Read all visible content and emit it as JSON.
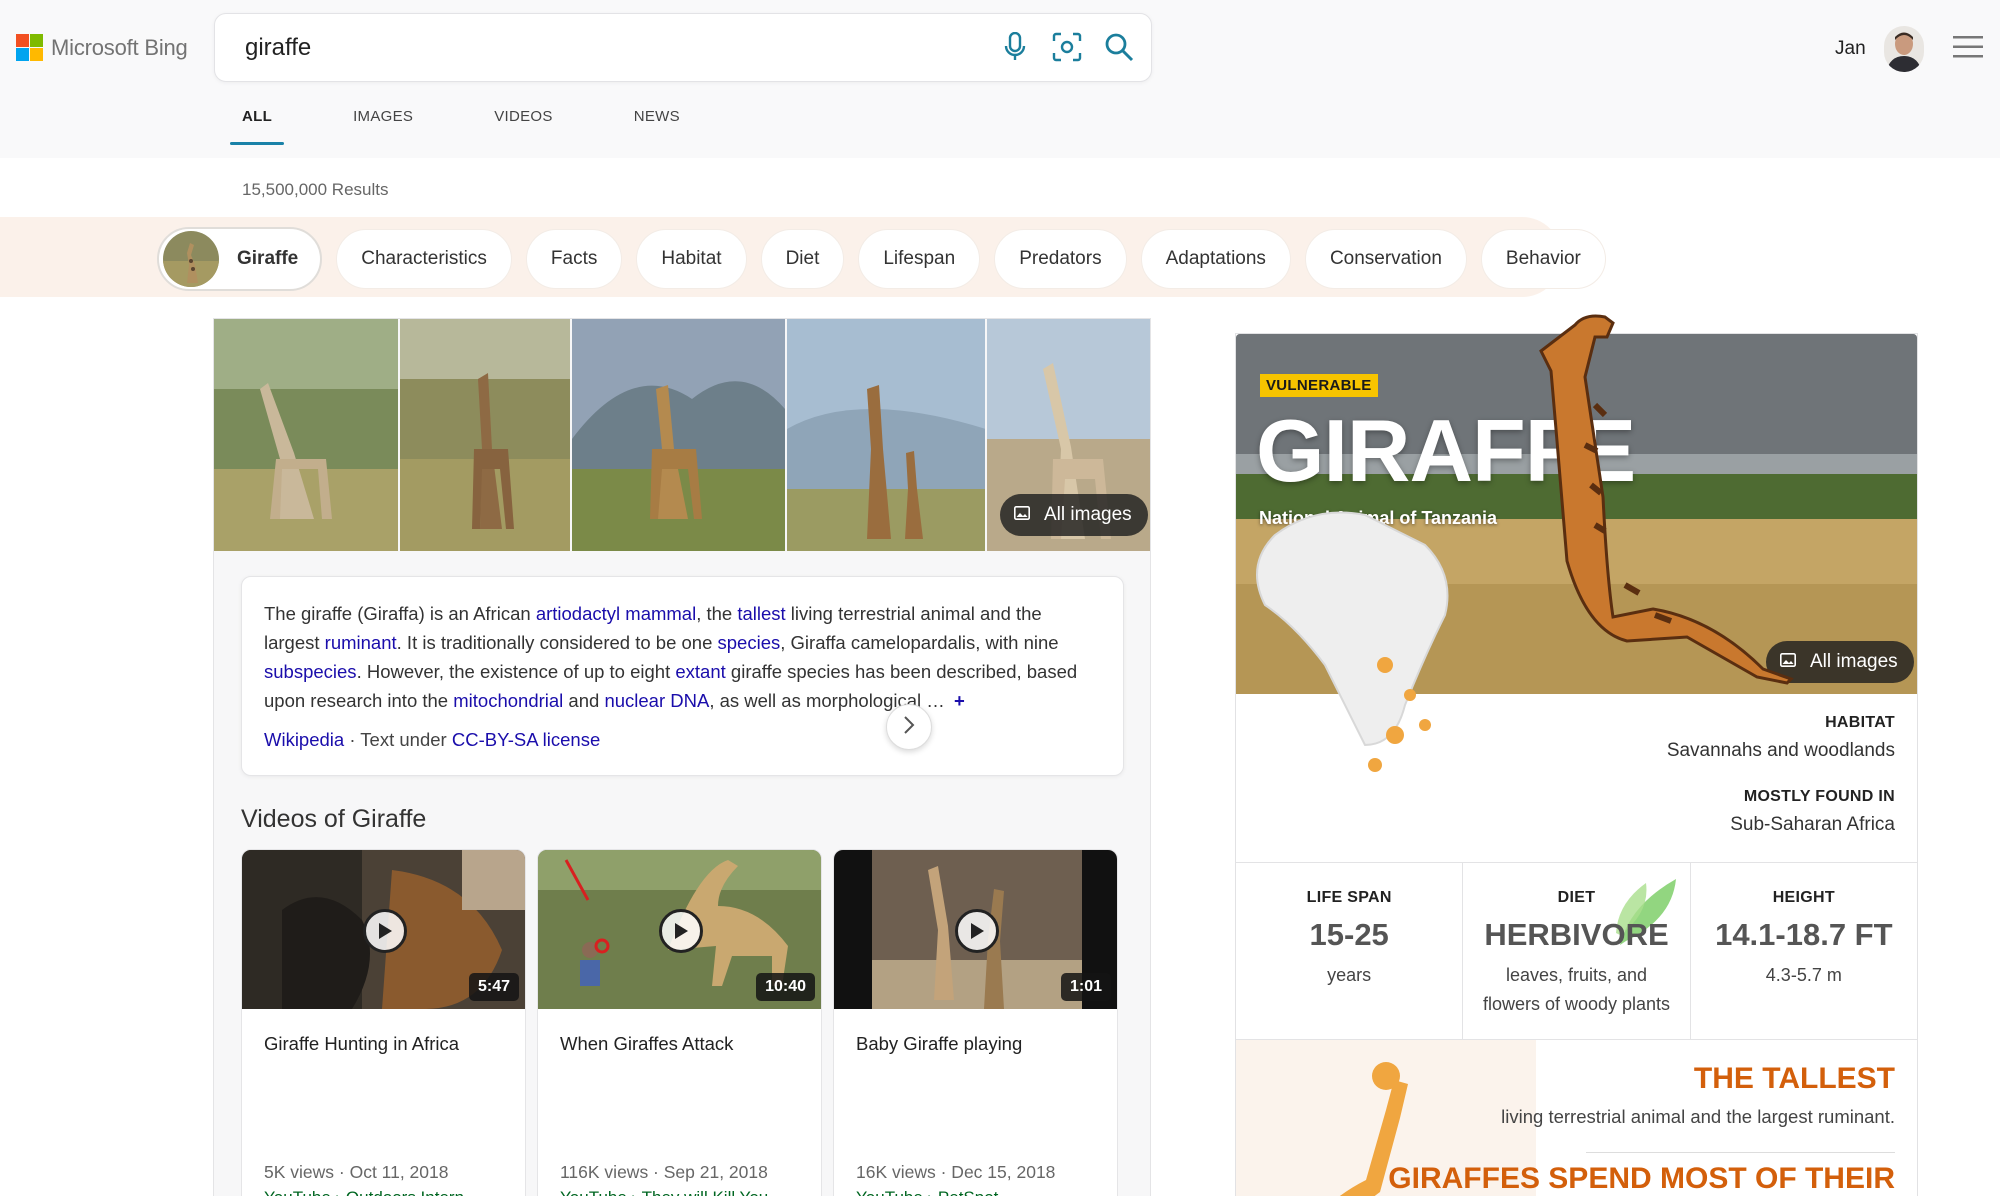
{
  "brand": {
    "name": "Microsoft Bing"
  },
  "search": {
    "query": "giraffe"
  },
  "user": {
    "name": "Jan"
  },
  "tabs": [
    {
      "label": "ALL",
      "active": true
    },
    {
      "label": "IMAGES"
    },
    {
      "label": "VIDEOS"
    },
    {
      "label": "NEWS"
    }
  ],
  "results_count": "15,500,000 Results",
  "chips": {
    "main": "Giraffe",
    "items": [
      "Characteristics",
      "Facts",
      "Habitat",
      "Diet",
      "Lifespan",
      "Predators",
      "Adaptations",
      "Conservation",
      "Behavior"
    ]
  },
  "gallery": {
    "all_images_label": "All images"
  },
  "description": {
    "t1": "The giraffe (Giraffa) is an African ",
    "l1": "artiodactyl",
    "t2": " ",
    "l2": "mammal",
    "t3": ", the ",
    "l3": "tallest",
    "t4": " living terrestrial animal and the largest ",
    "l4": "ruminant",
    "t5": ". It is traditionally considered to be one ",
    "l5": "species",
    "t6": ", Giraffa camelopardalis, with nine ",
    "l6": "subspecies",
    "t7": ". However, the existence of up to eight ",
    "l7": "extant",
    "t8": " giraffe species has been described, based upon research into the ",
    "l8": "mitochondrial",
    "t9": " and ",
    "l9": "nuclear DNA",
    "t10": ", as well as morphological … ",
    "more": "+",
    "source": "Wikipedia",
    "source_sep": " · Text under ",
    "license": "CC-BY-SA license"
  },
  "videos": {
    "title": "Videos of Giraffe",
    "items": [
      {
        "title": "Giraffe Hunting in Africa",
        "duration": "5:47",
        "meta": "5K views · Oct 11, 2018",
        "source": "YouTube › Outdoors Intern…"
      },
      {
        "title": "When Giraffes Attack",
        "duration": "10:40",
        "meta": "116K views · Sep 21, 2018",
        "source": "YouTube › They will Kill You"
      },
      {
        "title": "Baby Giraffe playing",
        "duration": "1:01",
        "meta": "16K views · Dec 15, 2018",
        "source": "YouTube › PetSpot"
      }
    ]
  },
  "panel": {
    "badge": "VULNERABLE",
    "title": "GIRAFFE",
    "subtitle": "National Animal of Tanzania",
    "all_images_label": "All images",
    "habitat_label": "HABITAT",
    "habitat_value": "Savannahs and woodlands",
    "found_label": "MOSTLY FOUND IN",
    "found_value": "Sub-Saharan Africa",
    "stats": [
      {
        "label": "LIFE SPAN",
        "value": "15-25",
        "sub": "years"
      },
      {
        "label": "DIET",
        "value": "HERBIVORE",
        "sub": "leaves, fruits, and flowers of woody plants"
      },
      {
        "label": "HEIGHT",
        "value": "14.1-18.7 FT",
        "sub": "4.3-5.7 m"
      }
    ],
    "fact1_title": "THE TALLEST",
    "fact1_text": "living terrestrial animal and the largest ruminant.",
    "fact2_title": "GIRAFFES SPEND MOST OF THEIR"
  },
  "colors": {
    "accent": "#1a82a8",
    "link": "#1a0dab",
    "fact": "#d35f0b",
    "badge": "#f7c400"
  }
}
